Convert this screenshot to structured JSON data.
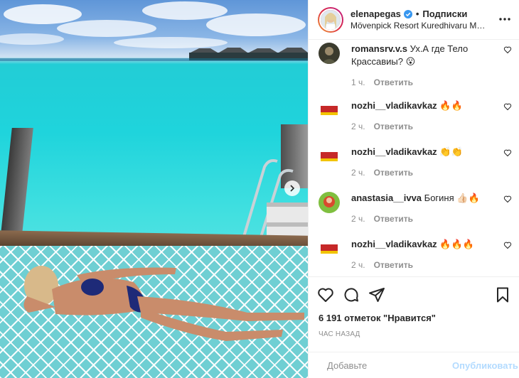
{
  "post": {
    "username": "elenapegas",
    "follow_label": "Подписки",
    "location": "Mövenpick Resort Kuredhivaru Maldives",
    "more_icon": "ellipsis-icon",
    "verified_color": "#3897f0"
  },
  "comments": [
    {
      "user": "romansrv.v.s",
      "text": "Ух.А где Тело Крассавиы?",
      "emoji": "😮",
      "time": "1 ч.",
      "reply": "Ответить"
    },
    {
      "user": "nozhi__vladikavkaz",
      "text": "",
      "emoji": "🔥🔥",
      "time": "2 ч.",
      "reply": "Ответить"
    },
    {
      "user": "nozhi__vladikavkaz",
      "text": "",
      "emoji": "👏👏",
      "time": "2 ч.",
      "reply": "Ответить"
    },
    {
      "user": "anastasia__ivva",
      "text": "Богиня",
      "emoji": "👍🏻🔥",
      "time": "2 ч.",
      "reply": "Ответить"
    },
    {
      "user": "nozhi__vladikavkaz",
      "text": "",
      "emoji": "🔥🔥🔥",
      "time": "2 ч.",
      "reply": "Ответить"
    }
  ],
  "actions": {
    "likes": "6 191 отметок \"Нравится\"",
    "posted": "ЧАС НАЗАД",
    "icons": [
      "heart-icon",
      "comment-icon",
      "share-icon",
      "bookmark-icon"
    ]
  },
  "composer": {
    "placeholder": "Добавьте",
    "publish_label": "Опубликовать",
    "publish_color": "#b3dbff"
  },
  "colors": {
    "border": "#efefef",
    "muted": "#8e8e8e",
    "text": "#262626"
  }
}
